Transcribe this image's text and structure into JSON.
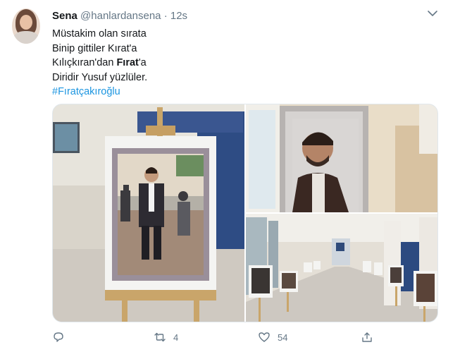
{
  "tweet": {
    "author_name": "Sena",
    "author_handle": "@hanlardansena",
    "separator": "·",
    "timestamp": "12s",
    "lines": [
      "Müstakim olan sırata",
      "Binip gittiler Kırat'a",
      "Kılıçkıran'dan "
    ],
    "line3_bold": "Fırat",
    "line3_tail": "'a",
    "line4": "Diridir Yusuf yüzlüler.",
    "hashtag": "#Fıratçakıroğlu"
  },
  "media": {
    "image_count": 3
  },
  "actions": {
    "reply_icon": "reply-icon",
    "retweet_icon": "retweet-icon",
    "retweet_count": "4",
    "like_icon": "heart-icon",
    "like_count": "54",
    "share_icon": "share-icon"
  },
  "colors": {
    "link": "#1b95e0",
    "muted": "#657786",
    "text": "#14171a"
  }
}
